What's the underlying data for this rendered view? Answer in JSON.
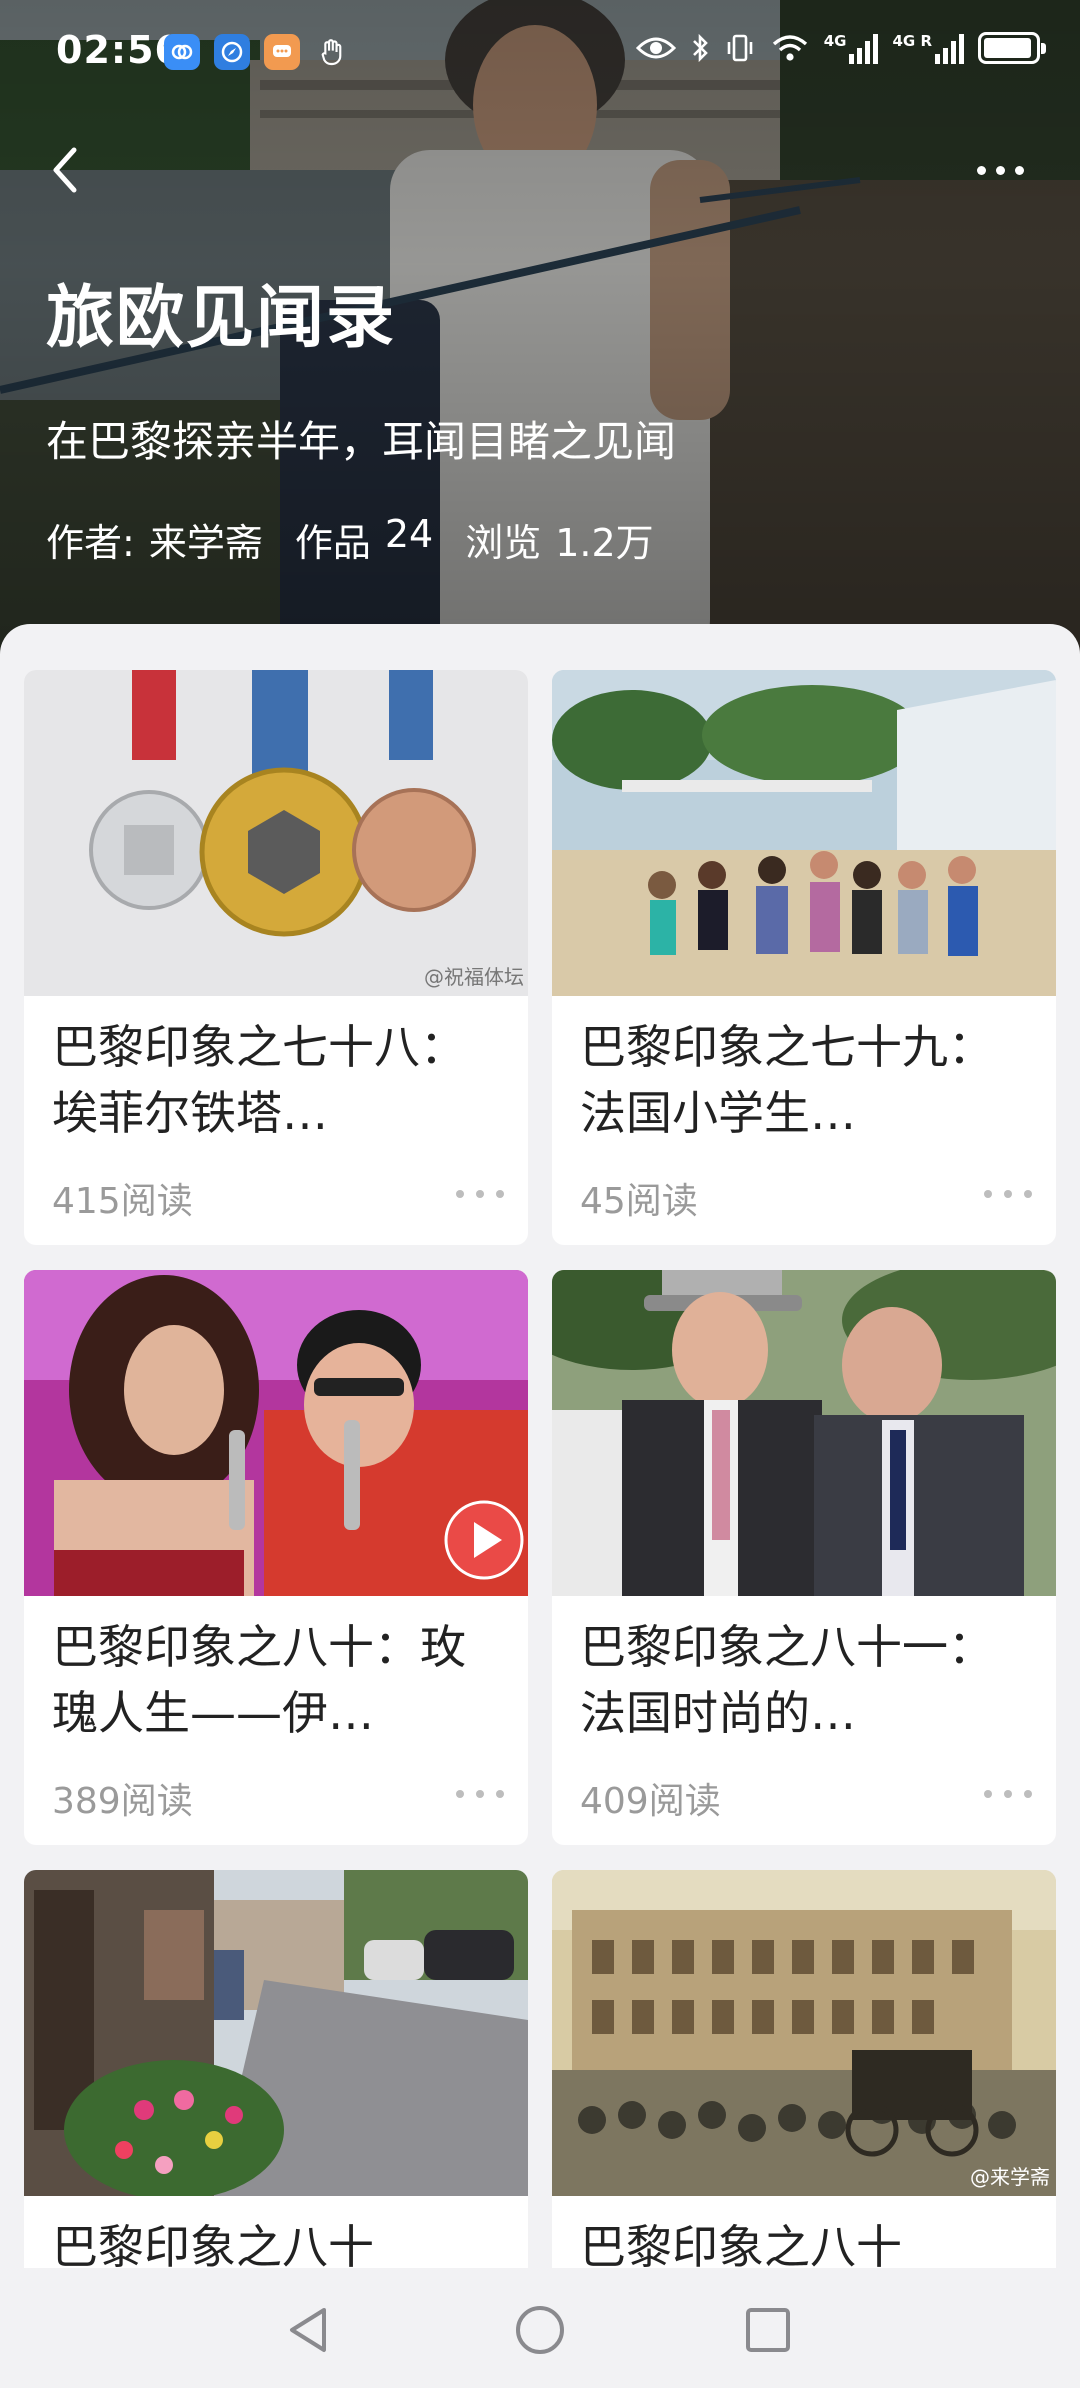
{
  "status_bar": {
    "time": "02:56",
    "net1": "4G",
    "net2": "4G R",
    "battery_level": 0.95
  },
  "column": {
    "title": "旅欧见闻录",
    "subtitle": "在巴黎探亲半年，耳闻目睹之见闻",
    "author_label": "作者:",
    "author": "来学斋",
    "works_label": "作品",
    "works_count": "24",
    "views_label": "浏览",
    "views_count": "1.2万"
  },
  "articles": [
    {
      "title": "巴黎印象之七十八：埃菲尔铁塔…",
      "reads": "415阅读",
      "watermark": "@祝福体坛",
      "thumb": "olympic-medals"
    },
    {
      "title": "巴黎印象之七十九：法国小学生…",
      "reads": "45阅读",
      "thumb": "schoolchildren-group"
    },
    {
      "title": "巴黎印象之八十：玫瑰人生——伊…",
      "reads": "389阅读",
      "thumb": "singers-duet"
    },
    {
      "title": "巴黎印象之八十一：法国时尚的…",
      "reads": "409阅读",
      "thumb": "two-men-suits"
    },
    {
      "title": "巴黎印象之八十",
      "reads": "",
      "thumb": "village-street"
    },
    {
      "title": "巴黎印象之八十",
      "reads": "",
      "watermark": "@来学斋",
      "thumb": "historic-painting"
    }
  ],
  "colors": {
    "background": "#f2f2f4",
    "card": "#ffffff",
    "title_text": "#222222",
    "muted_text": "#9a9a9a"
  }
}
